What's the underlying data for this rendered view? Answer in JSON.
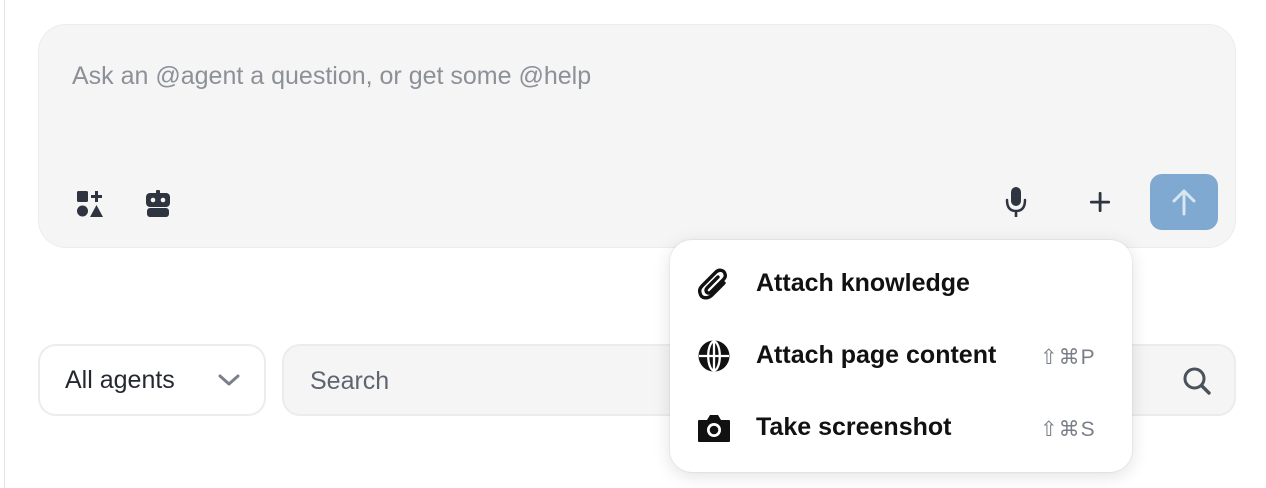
{
  "composer": {
    "placeholder": "Ask an @agent a question, or get some @help",
    "tools_icon": "tools-shapes-icon",
    "agent_icon": "robot-icon",
    "mic_icon": "microphone-icon",
    "plus_icon": "plus-icon",
    "send_icon": "arrow-up-icon",
    "send_color": "#7fa9d1"
  },
  "attach_menu": {
    "items": [
      {
        "label": "Attach knowledge",
        "icon": "paperclip-icon",
        "shortcut": ""
      },
      {
        "label": "Attach page content",
        "icon": "globe-icon",
        "shortcut": "⇧⌘P"
      },
      {
        "label": "Take screenshot",
        "icon": "camera-icon",
        "shortcut": "⇧⌘S"
      }
    ]
  },
  "filters": {
    "agent_select": {
      "selected": "All agents",
      "icon": "chevron-down-icon"
    },
    "search": {
      "placeholder": "Search",
      "icon": "search-icon"
    }
  }
}
